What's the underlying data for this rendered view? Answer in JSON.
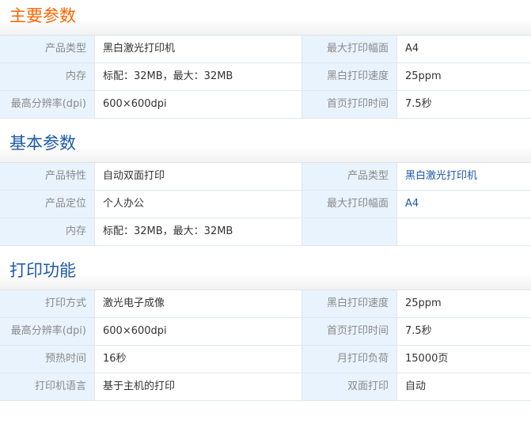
{
  "sections": [
    {
      "title": "主要参数",
      "rows": [
        {
          "l1": "产品类型",
          "v1": "黑白激光打印机",
          "l2": "最大打印幅面",
          "v2": "A4"
        },
        {
          "l1": "内存",
          "v1": "标配：32MB，最大：32MB",
          "l2": "黑白打印速度",
          "v2": "25ppm"
        },
        {
          "l1": "最高分辨率(dpi)",
          "v1": "600×600dpi",
          "l2": "首页打印时间",
          "v2": "7.5秒"
        }
      ]
    },
    {
      "title": "基本参数",
      "rows": [
        {
          "l1": "产品特性",
          "v1": "自动双面打印",
          "l2": "产品类型",
          "v2": "黑白激光打印机"
        },
        {
          "l1": "产品定位",
          "v1": "个人办公",
          "l2": "最大打印幅面",
          "v2": "A4"
        },
        {
          "l1": "内存",
          "v1": "标配：32MB，最大：32MB",
          "l2": "",
          "v2": ""
        }
      ]
    },
    {
      "title": "打印功能",
      "rows": [
        {
          "l1": "打印方式",
          "v1": "激光电子成像",
          "l2": "黑白打印速度",
          "v2": "25ppm"
        },
        {
          "l1": "最高分辨率(dpi)",
          "v1": "600×600dpi",
          "l2": "首页打印时间",
          "v2": "7.5秒"
        },
        {
          "l1": "预热时间",
          "v1": "16秒",
          "l2": "月打印负荷",
          "v2": "15000页"
        },
        {
          "l1": "打印机语言",
          "v1": "基于主机的打印",
          "l2": "双面打印",
          "v2": "自动"
        }
      ]
    }
  ],
  "colors": {
    "title_primary": "#ff6600",
    "title_secondary": "#1d5aa6",
    "label_bg": "#e8f3fd",
    "label_text": "#8a8a8a",
    "link_text": "#1d5aa6"
  }
}
